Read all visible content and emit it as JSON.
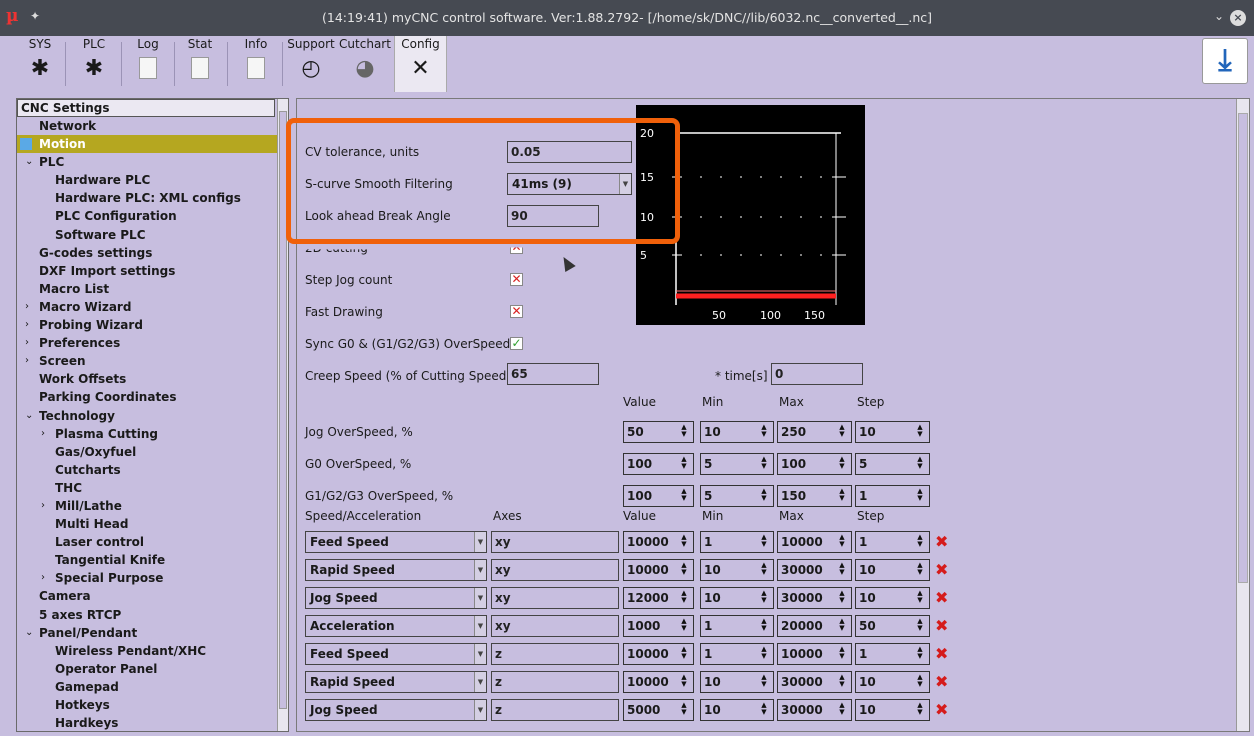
{
  "window": {
    "title": "(14:19:41) myCNC control software. Ver:1.88.2792- [/home/sk/DNC//lib/6032.nc__converted__.nc]",
    "logo": "µ"
  },
  "toolbar": {
    "buttons": [
      {
        "label": "SYS",
        "icon": "gear-icon"
      },
      {
        "label": "PLC",
        "icon": "gear-icon"
      },
      {
        "label": "Log",
        "icon": "document-icon"
      },
      {
        "label": "Stat",
        "icon": "document-icon"
      },
      {
        "label": "Info",
        "icon": "document-icon"
      },
      {
        "label": "Support",
        "icon": "gauge-icon"
      },
      {
        "label": "Cutchart",
        "icon": "pie-chart-icon"
      },
      {
        "label": "Config",
        "icon": "tools-icon"
      }
    ],
    "active": "Config",
    "download_icon": "download-icon"
  },
  "tree": {
    "header": "CNC Settings",
    "items": [
      {
        "label": "Network",
        "level": 1
      },
      {
        "label": "Motion",
        "level": 1,
        "selected": true
      },
      {
        "label": "PLC",
        "level": 1,
        "expanded": true
      },
      {
        "label": "Hardware PLC",
        "level": 2
      },
      {
        "label": "Hardware PLC: XML configs",
        "level": 2
      },
      {
        "label": "PLC Configuration",
        "level": 2
      },
      {
        "label": "Software PLC",
        "level": 2
      },
      {
        "label": "G-codes settings",
        "level": 1
      },
      {
        "label": "DXF Import settings",
        "level": 1
      },
      {
        "label": "Macro List",
        "level": 1
      },
      {
        "label": "Macro Wizard",
        "level": 1,
        "collapsed": true
      },
      {
        "label": "Probing Wizard",
        "level": 1,
        "collapsed": true
      },
      {
        "label": "Preferences",
        "level": 1,
        "collapsed": true
      },
      {
        "label": "Screen",
        "level": 1,
        "collapsed": true
      },
      {
        "label": "Work Offsets",
        "level": 1
      },
      {
        "label": "Parking Coordinates",
        "level": 1
      },
      {
        "label": "Technology",
        "level": 1,
        "expanded": true
      },
      {
        "label": "Plasma Cutting",
        "level": 2,
        "collapsed": true
      },
      {
        "label": "Gas/Oxyfuel",
        "level": 2
      },
      {
        "label": "Cutcharts",
        "level": 2
      },
      {
        "label": "THC",
        "level": 2
      },
      {
        "label": "Mill/Lathe",
        "level": 2,
        "collapsed": true
      },
      {
        "label": "Multi Head",
        "level": 2
      },
      {
        "label": "Laser control",
        "level": 2
      },
      {
        "label": "Tangential Knife",
        "level": 2
      },
      {
        "label": "Special Purpose",
        "level": 2,
        "collapsed": true
      },
      {
        "label": "Camera",
        "level": 1
      },
      {
        "label": "5 axes RTCP",
        "level": 1
      },
      {
        "label": "Panel/Pendant",
        "level": 1,
        "expanded": true
      },
      {
        "label": "Wireless Pendant/XHC",
        "level": 2
      },
      {
        "label": "Operator Panel",
        "level": 2
      },
      {
        "label": "Gamepad",
        "level": 2
      },
      {
        "label": "Hotkeys",
        "level": 2
      },
      {
        "label": "Hardkeys",
        "level": 2
      }
    ]
  },
  "settings": {
    "cv_tolerance": {
      "label": "CV tolerance, units",
      "value": "0.05"
    },
    "scurve": {
      "label": "S-curve Smooth Filtering",
      "value": "41ms (9)"
    },
    "lookahead": {
      "label": "Look ahead Break Angle",
      "value": "90"
    },
    "cutting2d": {
      "label": "2D cutting",
      "checked": false
    },
    "step_jog": {
      "label": "Step Jog count",
      "checked": false
    },
    "fast_drawing": {
      "label": "Fast Drawing",
      "checked": false
    },
    "sync": {
      "label": "Sync G0 & (G1/G2/G3) OverSpeed",
      "checked": true
    },
    "creep": {
      "label": "Creep Speed (% of Cutting Speed)",
      "value": "65",
      "time_label": "* time[s]",
      "time_value": "0"
    }
  },
  "overspeed": {
    "headers": [
      "Value",
      "Min",
      "Max",
      "Step"
    ],
    "rows": [
      {
        "label": "Jog OverSpeed, %",
        "value": "50",
        "min": "10",
        "max": "250",
        "step": "10"
      },
      {
        "label": "G0 OverSpeed, %",
        "value": "100",
        "min": "5",
        "max": "100",
        "step": "5"
      },
      {
        "label": "G1/G2/G3 OverSpeed, %",
        "value": "100",
        "min": "5",
        "max": "150",
        "step": "1"
      }
    ]
  },
  "speedtable": {
    "headers": [
      "Speed/Acceleration",
      "Axes",
      "Value",
      "Min",
      "Max",
      "Step"
    ],
    "rows": [
      {
        "type": "Feed Speed",
        "axes": "xy",
        "value": "10000",
        "min": "1",
        "max": "10000",
        "step": "1"
      },
      {
        "type": "Rapid Speed",
        "axes": "xy",
        "value": "10000",
        "min": "10",
        "max": "30000",
        "step": "10"
      },
      {
        "type": "Jog Speed",
        "axes": "xy",
        "value": "12000",
        "min": "10",
        "max": "30000",
        "step": "10"
      },
      {
        "type": "Acceleration",
        "axes": "xy",
        "value": "1000",
        "min": "1",
        "max": "20000",
        "step": "50"
      },
      {
        "type": "Feed Speed",
        "axes": "z",
        "value": "10000",
        "min": "1",
        "max": "10000",
        "step": "1"
      },
      {
        "type": "Rapid Speed",
        "axes": "z",
        "value": "10000",
        "min": "10",
        "max": "30000",
        "step": "10"
      },
      {
        "type": "Jog Speed",
        "axes": "z",
        "value": "5000",
        "min": "10",
        "max": "30000",
        "step": "10"
      }
    ]
  },
  "plot": {
    "yticks": [
      "20",
      "15",
      "10",
      "5"
    ],
    "xticks": [
      "50",
      "100",
      "150"
    ],
    "line_color": "#ff2020"
  }
}
